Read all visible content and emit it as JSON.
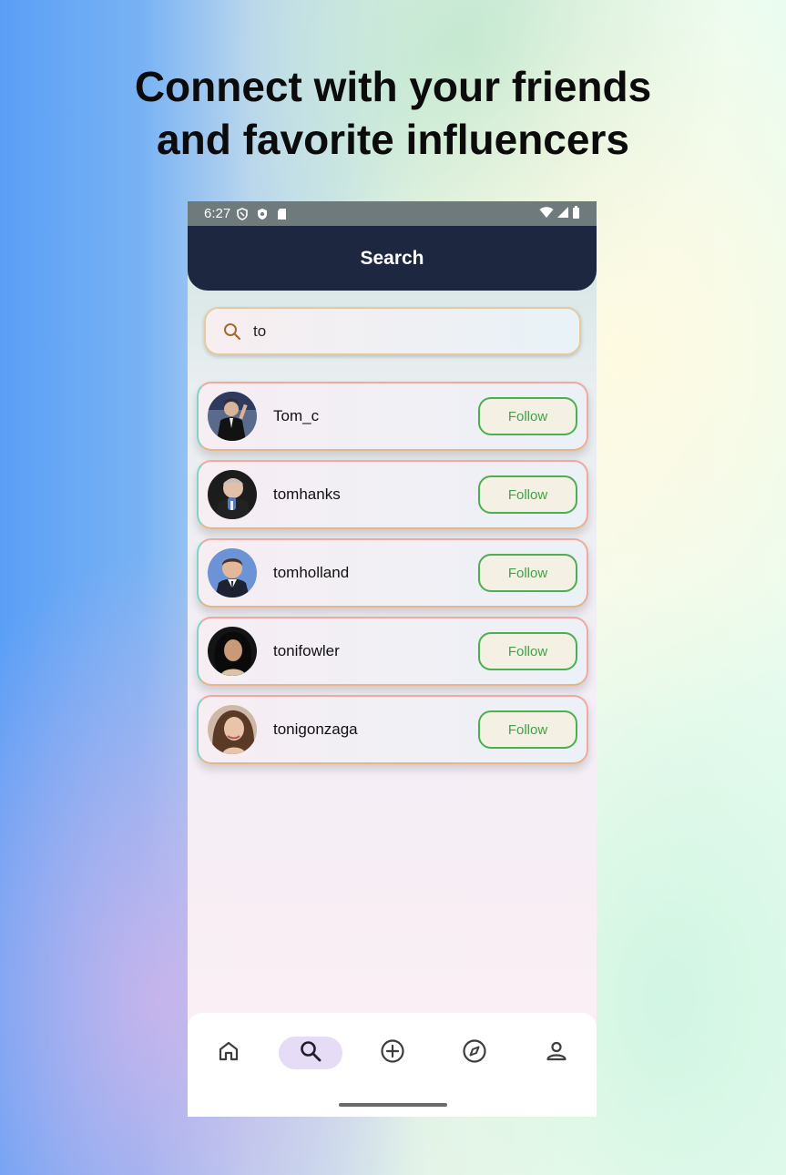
{
  "headline": {
    "line1": "Connect with your friends",
    "line2": "and favorite influencers"
  },
  "status_bar": {
    "time": "6:27",
    "left_icons": [
      "shield-outline-icon",
      "shield-filled-icon",
      "sd-card-icon"
    ],
    "right_icons": [
      "wifi-icon",
      "cellular-signal-icon",
      "battery-icon"
    ]
  },
  "app_bar": {
    "title": "Search"
  },
  "search": {
    "value": "to",
    "icon": "search-icon"
  },
  "results": [
    {
      "username": "Tom_c",
      "follow_label": "Follow"
    },
    {
      "username": "tomhanks",
      "follow_label": "Follow"
    },
    {
      "username": "tomholland",
      "follow_label": "Follow"
    },
    {
      "username": "tonifowler",
      "follow_label": "Follow"
    },
    {
      "username": "tonigonzaga",
      "follow_label": "Follow"
    }
  ],
  "bottom_nav": {
    "items": [
      "home-icon",
      "search-icon",
      "add-circle-icon",
      "explore-compass-icon",
      "profile-icon"
    ],
    "active": "search-icon"
  },
  "colors": {
    "app_bar": "#1e2740",
    "follow_border": "#4caf50",
    "follow_text": "#43a047",
    "active_nav": "#e6dcf5"
  }
}
